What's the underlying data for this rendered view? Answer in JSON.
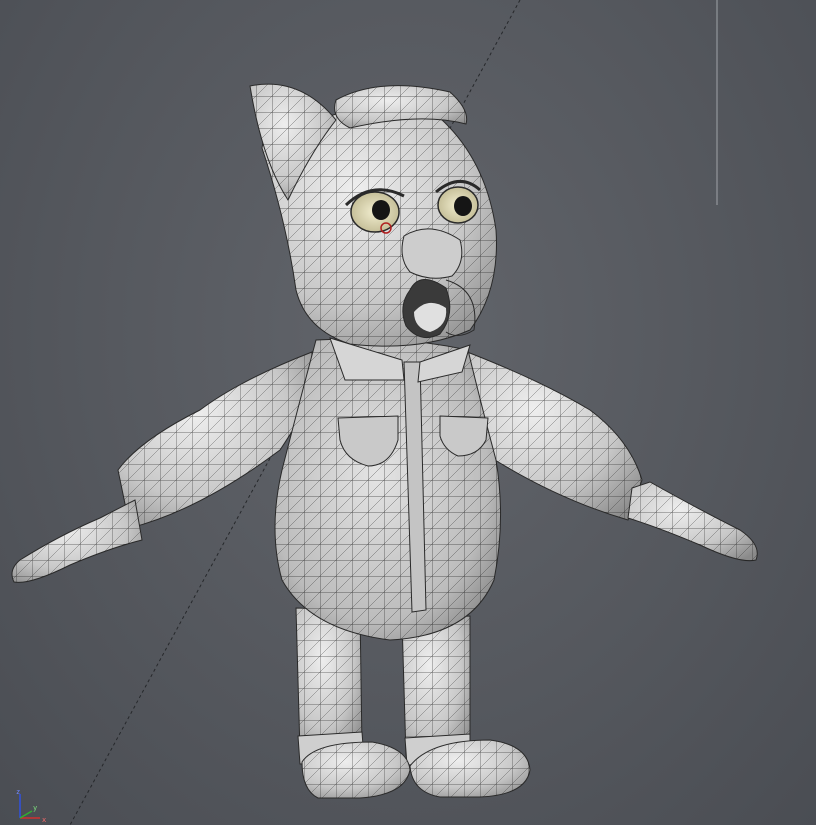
{
  "viewport": {
    "mode": "3d-perspective",
    "shading": "smooth-shaded-with-wireframe",
    "background_color": "#585b61",
    "model_color": "#d4d4d4",
    "wire_color": "#222222",
    "selected_color": "#b02020"
  },
  "model": {
    "subject": "cartoon-bulldog-character",
    "pose": "t-pose"
  },
  "axis_gizmo": {
    "x_label": "x",
    "y_label": "y",
    "z_label": "z",
    "x_color": "#d03030",
    "y_color": "#30b030",
    "z_color": "#3050e0"
  }
}
